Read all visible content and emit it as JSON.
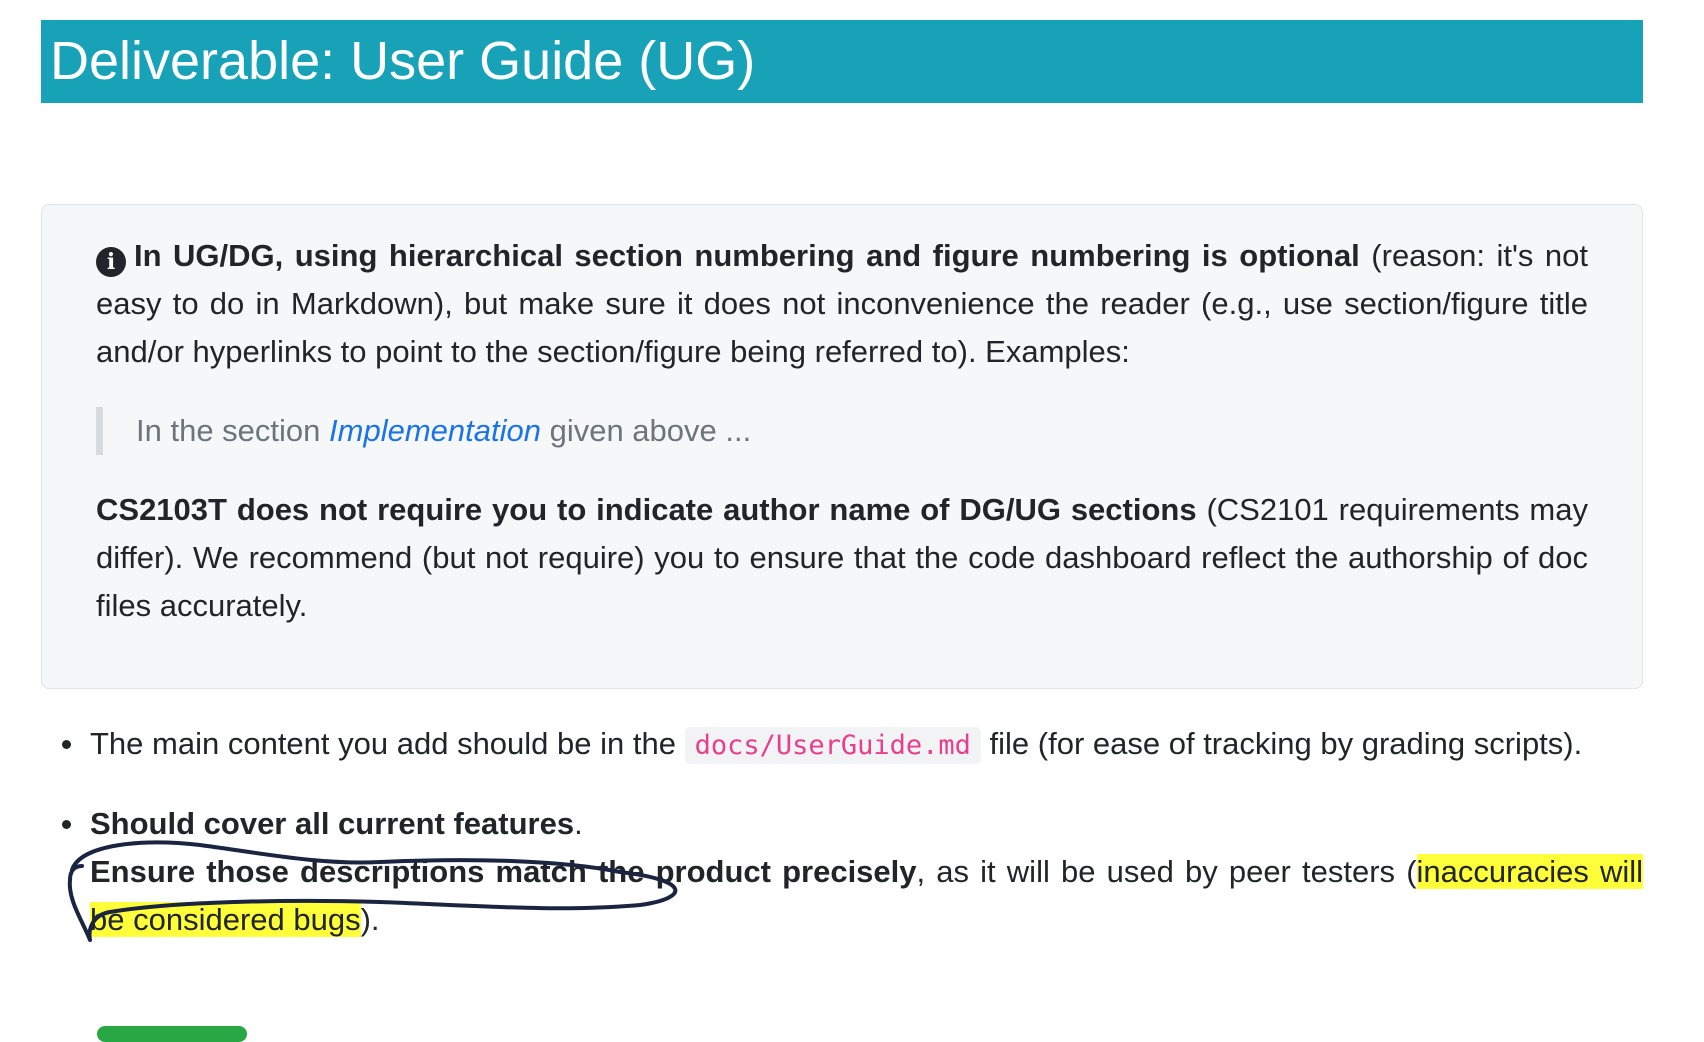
{
  "header": {
    "title": "Deliverable: User Guide (UG)"
  },
  "info_box": {
    "icon": "info-circle-icon",
    "p1_bold": "In UG/DG, using hierarchical section numbering and figure numbering is optional",
    "p1_rest": " (reason: it's not easy to do in Markdown), but make sure it does not inconvenience the reader (e.g., use section/figure title and/or hyperlinks to point to the section/figure being referred to). Examples:",
    "quote_prefix": "In the section ",
    "quote_link": "Implementation",
    "quote_suffix": " given above ...",
    "p2_bold": "CS2103T does not require you to indicate author name of DG/UG sections",
    "p2_rest": " (CS2101 requirements may differ). We recommend (but not require) you to ensure that the code dashboard reflect the authorship of doc files accurately."
  },
  "bullets": {
    "item1": {
      "before": "The main content you add should be in the ",
      "code": "docs/UserGuide.md",
      "after": " file (for ease of tracking by grading scripts)."
    },
    "item2": {
      "bold1": "Should cover all current features",
      "after_bold1": ".",
      "bold2": "Ensure those descriptions match the product precisely",
      "middle": ", as it will be used by peer testers (",
      "highlight": "inaccuracies will be considered bugs",
      "end": ")."
    }
  },
  "colors": {
    "header_bg": "#17a2b8",
    "highlight": "#ffff3a",
    "code_text": "#e83e8c",
    "link": "#1a73e8",
    "annotation_ink": "#1b2440"
  }
}
